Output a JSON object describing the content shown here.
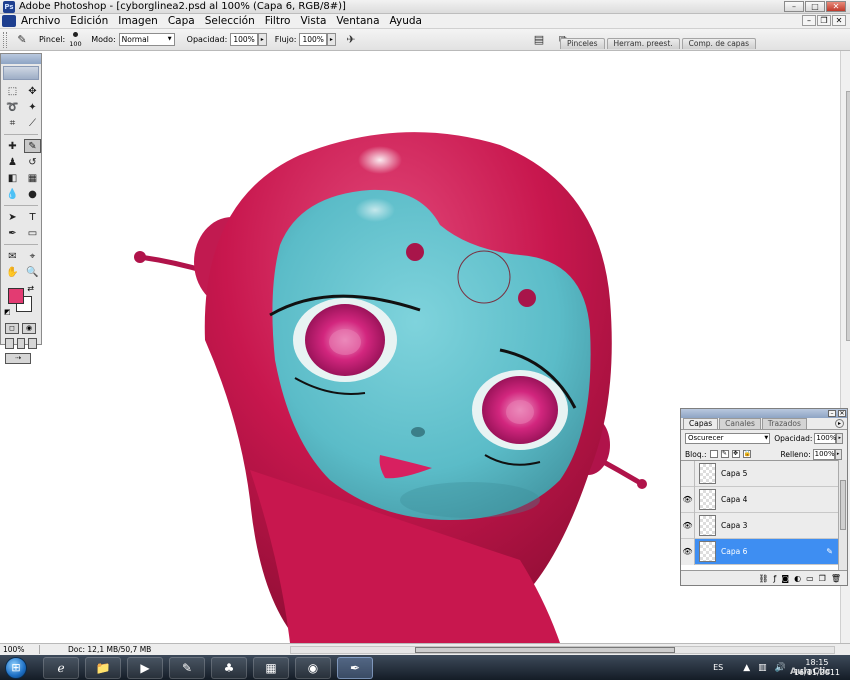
{
  "window": {
    "title": "Adobe Photoshop - [cyborglinea2.psd al 100% (Capa 6, RGB/8#)]",
    "ps_icon": "Ps"
  },
  "menu": [
    "Archivo",
    "Edición",
    "Imagen",
    "Capa",
    "Selección",
    "Filtro",
    "Vista",
    "Ventana",
    "Ayuda"
  ],
  "options": {
    "pincel_label": "Pincel:",
    "brush_size": "100",
    "modo_label": "Modo:",
    "modo_value": "Normal",
    "opacidad_label": "Opacidad:",
    "opacidad_value": "100%",
    "flujo_label": "Flujo:",
    "flujo_value": "100%"
  },
  "palette_well": [
    "Pinceles",
    "Herram. preest.",
    "Comp. de capas"
  ],
  "colors": {
    "foreground": "#e33b72",
    "background": "#ffffff",
    "helmet": "#c8174e",
    "face": "#5bbcc8",
    "eye": "#d2267e",
    "selection": "#3e8ef2"
  },
  "status": {
    "zoom": "100%",
    "doc": "Doc: 12,1 MB/50,7 MB"
  },
  "layers": {
    "tabs": [
      "Capas",
      "Canales",
      "Trazados"
    ],
    "blend_mode": "Oscurecer",
    "opacidad_label": "Opacidad:",
    "opacidad_value": "100%",
    "bloq_label": "Bloq.:",
    "relleno_label": "Relleno:",
    "relleno_value": "100%",
    "items": [
      {
        "name": "Capa 5",
        "visible": false,
        "selected": false
      },
      {
        "name": "Capa 4",
        "visible": true,
        "selected": false
      },
      {
        "name": "Capa 3",
        "visible": true,
        "selected": false
      },
      {
        "name": "Capa 6",
        "visible": true,
        "selected": true
      }
    ]
  },
  "taskbar": {
    "lang": "ES",
    "time": "18:15",
    "date": "16/11/2011"
  },
  "watermark": "AulaClic"
}
